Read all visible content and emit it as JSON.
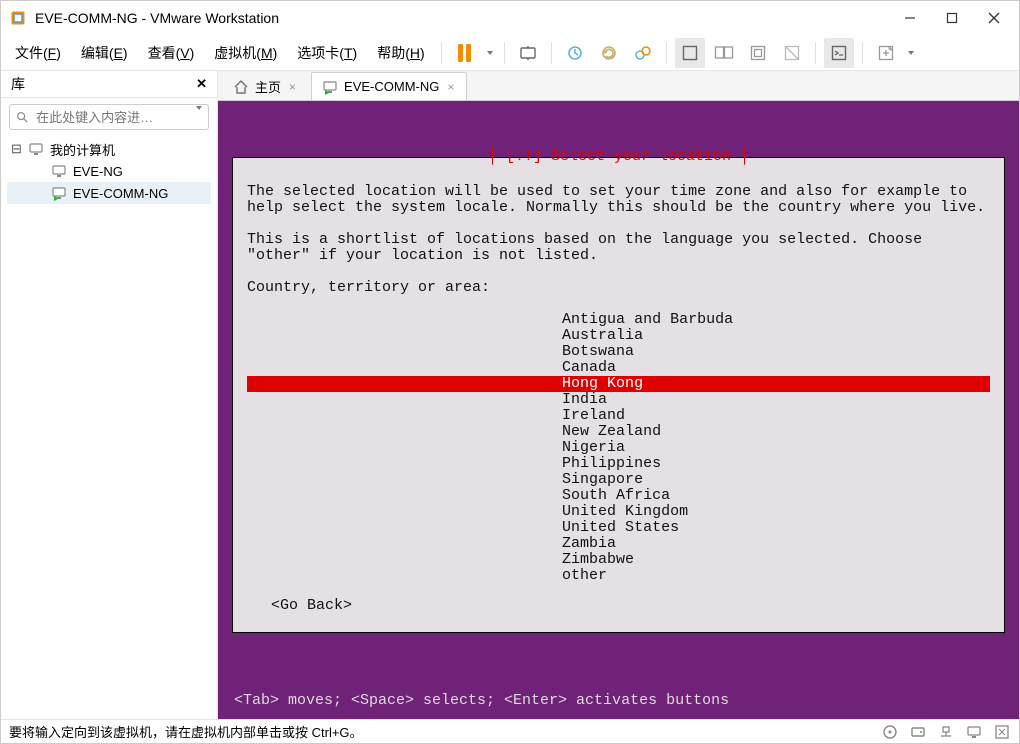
{
  "titlebar": {
    "title": "EVE-COMM-NG - VMware Workstation"
  },
  "menu": {
    "file": {
      "label": "文件",
      "mnemonic": "F"
    },
    "edit": {
      "label": "编辑",
      "mnemonic": "E"
    },
    "view": {
      "label": "查看",
      "mnemonic": "V"
    },
    "vm": {
      "label": "虚拟机",
      "mnemonic": "M"
    },
    "tabs": {
      "label": "选项卡",
      "mnemonic": "T"
    },
    "help": {
      "label": "帮助",
      "mnemonic": "H"
    }
  },
  "sidebar": {
    "header": "库",
    "search_placeholder": "在此处键入内容进…",
    "root": {
      "label": "我的计算机"
    },
    "items": [
      {
        "label": "EVE-NG",
        "selected": false
      },
      {
        "label": "EVE-COMM-NG",
        "selected": true
      }
    ]
  },
  "tabs": [
    {
      "label": "主页",
      "kind": "home",
      "active": false
    },
    {
      "label": "EVE-COMM-NG",
      "kind": "vm",
      "active": true
    }
  ],
  "installer": {
    "title_decorated": "[!!] Select your location",
    "para1": "The selected location will be used to set your time zone and also for example to help select the system locale. Normally this should be the country where you live.",
    "para2": "This is a shortlist of locations based on the language you selected. Choose \"other\" if your location is not listed.",
    "prompt": "Country, territory or area:",
    "options": [
      "Antigua and Barbuda",
      "Australia",
      "Botswana",
      "Canada",
      "Hong Kong",
      "India",
      "Ireland",
      "New Zealand",
      "Nigeria",
      "Philippines",
      "Singapore",
      "South Africa",
      "United Kingdom",
      "United States",
      "Zambia",
      "Zimbabwe",
      "other"
    ],
    "selected_index": 4,
    "go_back": "<Go Back>",
    "hint": "<Tab> moves; <Space> selects; <Enter> activates buttons"
  },
  "statusbar": {
    "text": "要将输入定向到该虚拟机，请在虚拟机内部单击或按 Ctrl+G。"
  }
}
